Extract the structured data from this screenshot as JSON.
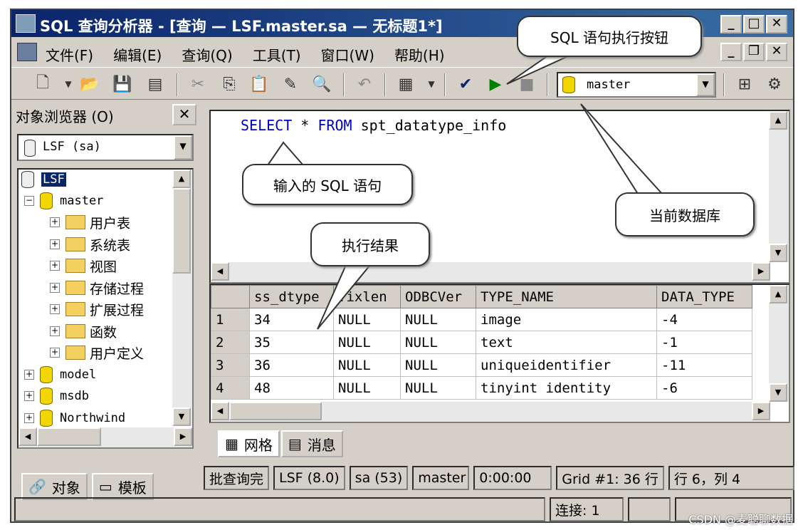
{
  "window": {
    "title": "SQL 查询分析器 - [查询 — LSF.master.sa — 无标题1*]"
  },
  "menu": {
    "items": [
      "文件(F)",
      "编辑(E)",
      "查询(Q)",
      "工具(T)",
      "窗口(W)",
      "帮助(H)"
    ]
  },
  "toolbar": {
    "database": "master"
  },
  "object_browser": {
    "title": "对象浏览器 (O)",
    "server": "LSF (sa)",
    "tree": [
      {
        "label": "LSF",
        "level": 0
      },
      {
        "label": "master",
        "level": 1
      },
      {
        "label": "用户表",
        "level": 2
      },
      {
        "label": "系统表",
        "level": 2
      },
      {
        "label": "视图",
        "level": 2
      },
      {
        "label": "存储过程",
        "level": 2
      },
      {
        "label": "扩展过程",
        "level": 2
      },
      {
        "label": "函数",
        "level": 2
      },
      {
        "label": "用户定义",
        "level": 2
      },
      {
        "label": "model",
        "level": 1
      },
      {
        "label": "msdb",
        "level": 1
      },
      {
        "label": "Northwind",
        "level": 1
      }
    ],
    "tabs": [
      "对象",
      "模板"
    ]
  },
  "editor": {
    "kw1": "SELECT",
    "star": " * ",
    "kw2": "FROM",
    "rest": " spt_datatype_info"
  },
  "results": {
    "columns": [
      "ss_dtype",
      "fixlen",
      "ODBCVer",
      "TYPE_NAME",
      "DATA_TYPE"
    ],
    "rows": [
      [
        "1",
        "34",
        "NULL",
        "NULL",
        "image",
        "-4"
      ],
      [
        "2",
        "35",
        "NULL",
        "NULL",
        "text",
        "-1"
      ],
      [
        "3",
        "36",
        "NULL",
        "NULL",
        "uniqueidentifier",
        "-11"
      ],
      [
        "4",
        "48",
        "NULL",
        "NULL",
        "tinyint identity",
        "-6"
      ]
    ],
    "tabs": [
      "网格",
      "消息"
    ]
  },
  "status": {
    "cells": [
      "批查询完",
      "LSF (8.0)",
      "sa (53)",
      "master",
      "0:00:00",
      "Grid #1: 36 行",
      "行 6，列 4"
    ],
    "connections": "连接: 1"
  },
  "callouts": {
    "exec_button": "SQL 语句执行按钮",
    "input_sql": "输入的 SQL 语句",
    "current_db": "当前数据库",
    "result": "执行结果"
  },
  "watermark": "CSDN @麦聪聊数据"
}
